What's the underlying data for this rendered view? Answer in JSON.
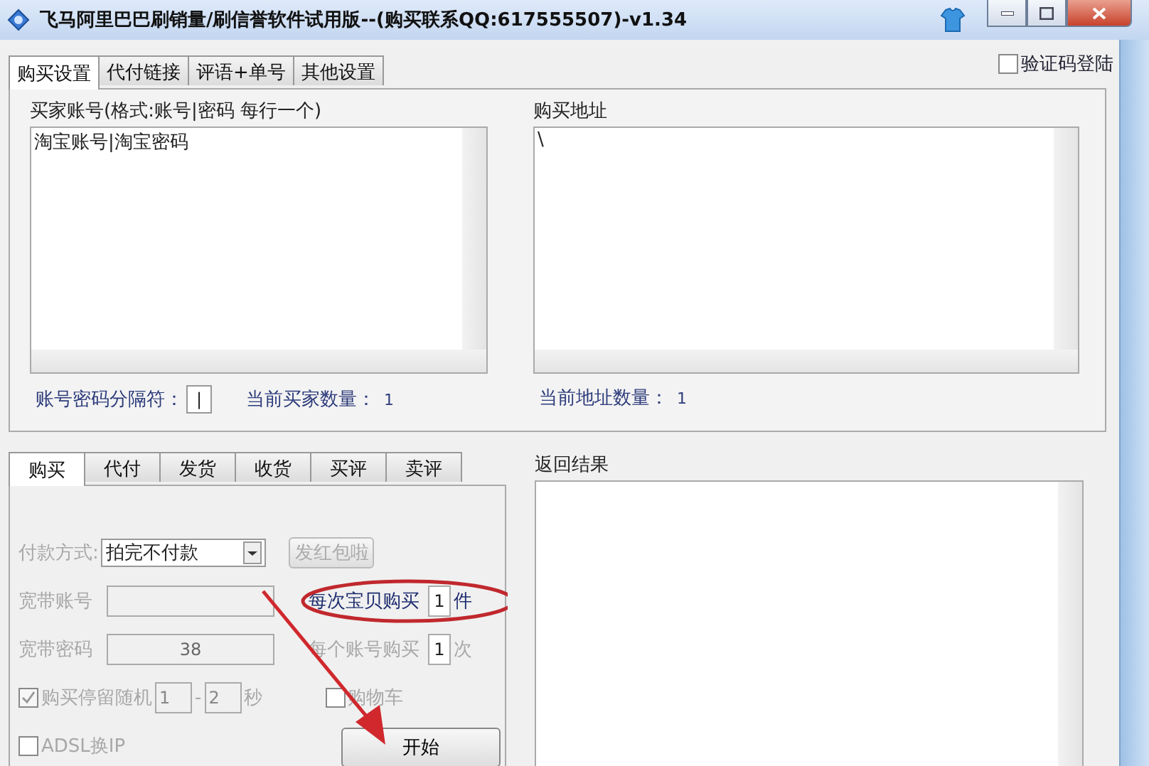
{
  "window": {
    "title": "飞马阿里巴巴刷销量/刷信誉软件试用版--(购买联系QQ:617555507)-v1.34"
  },
  "top_tabs": [
    {
      "label": "购买设置",
      "selected": true
    },
    {
      "label": "代付链接",
      "selected": false
    },
    {
      "label": "评语+单号",
      "selected": false
    },
    {
      "label": "其他设置",
      "selected": false
    }
  ],
  "captcha_login": {
    "label": "验证码登陆",
    "checked": false
  },
  "buyer_accounts": {
    "label": "买家账号(格式:账号|密码 每行一个)",
    "value": "淘宝账号|淘宝密码",
    "separator_label": "账号密码分隔符：",
    "separator_value": "|",
    "count_label": "当前买家数量：",
    "count": "1"
  },
  "purchase_urls": {
    "label": "购买地址",
    "value": "\\",
    "count_label": "当前地址数量：",
    "count": "1"
  },
  "bottom_tabs": [
    {
      "label": "购买",
      "selected": true
    },
    {
      "label": "代付",
      "selected": false
    },
    {
      "label": "发货",
      "selected": false
    },
    {
      "label": "收货",
      "selected": false
    },
    {
      "label": "买评",
      "selected": false
    },
    {
      "label": "卖评",
      "selected": false
    }
  ],
  "payment": {
    "label": "付款方式:",
    "value": "拍完不付款",
    "disabled": true
  },
  "red_packet_button": {
    "label": "发红包啦",
    "disabled": true
  },
  "broadband_account": {
    "label": "宽带账号",
    "disabled": true
  },
  "broadband_password": {
    "label": "宽带密码",
    "value": "38",
    "disabled": true
  },
  "per_item_qty": {
    "label": "每次宝贝购买",
    "value": "1",
    "unit": "件",
    "disabled": false
  },
  "per_account_times": {
    "label": "每个账号购买",
    "value": "1",
    "unit": "次",
    "disabled": true
  },
  "random_stay": {
    "label": "购买停留随机",
    "checked": true,
    "disabled": true,
    "min": "1",
    "separator": "-",
    "max": "2",
    "unit": "秒"
  },
  "cart": {
    "label": "购物车",
    "checked": false,
    "disabled": true
  },
  "adsl": {
    "label": "ADSL换IP",
    "checked": false,
    "disabled": true
  },
  "start_button": {
    "label": "开始"
  },
  "results": {
    "label": "返回结果"
  }
}
